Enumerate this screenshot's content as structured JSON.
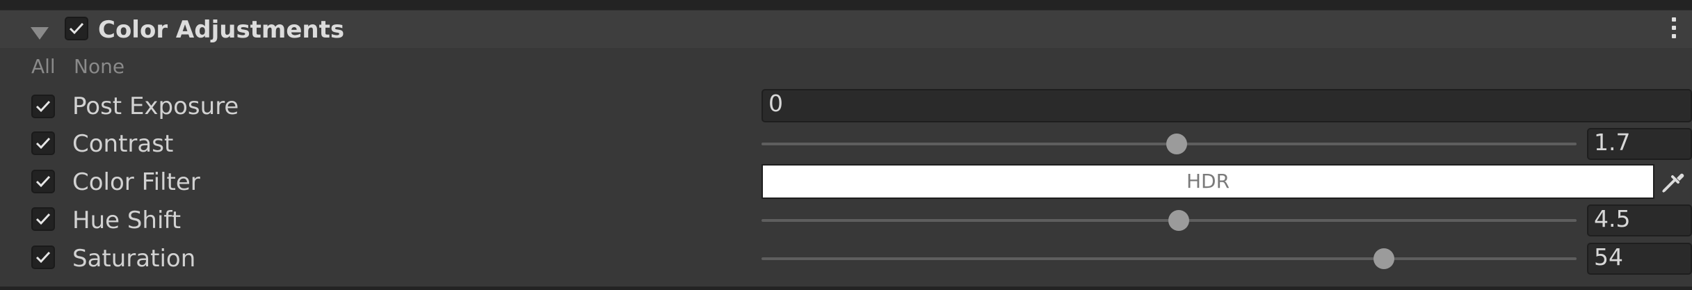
{
  "header": {
    "title": "Color Adjustments",
    "enabled": true
  },
  "quick_select": {
    "all_label": "All",
    "none_label": "None"
  },
  "properties": [
    {
      "label": "Post Exposure",
      "value": "0",
      "control": "float-field"
    },
    {
      "label": "Contrast",
      "value": "1.7",
      "control": "slider",
      "slider_position": 0.51
    },
    {
      "label": "Color Filter",
      "value": "HDR",
      "control": "color-field",
      "color": "#ffffff"
    },
    {
      "label": "Hue Shift",
      "value": "4.5",
      "control": "slider",
      "slider_position": 0.51
    },
    {
      "label": "Saturation",
      "value": "54",
      "control": "slider",
      "slider_position": 0.764
    }
  ],
  "icons": {
    "foldout": "foldout-triangle-icon",
    "menu": "kebab-menu-icon",
    "picker": "eyedropper-icon",
    "check": "checkmark-icon"
  }
}
